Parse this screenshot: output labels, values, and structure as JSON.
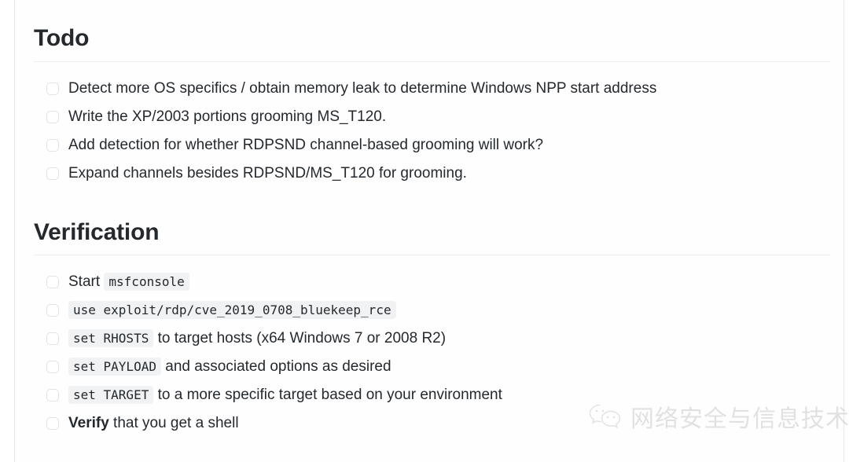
{
  "sections": [
    {
      "heading": "Todo",
      "items": [
        {
          "parts": [
            {
              "type": "text",
              "value": "Detect more OS specifics / obtain memory leak to determine Windows NPP start address"
            }
          ]
        },
        {
          "parts": [
            {
              "type": "text",
              "value": "Write the XP/2003 portions grooming MS_T120."
            }
          ]
        },
        {
          "parts": [
            {
              "type": "text",
              "value": "Add detection for whether RDPSND channel-based grooming will work?"
            }
          ]
        },
        {
          "parts": [
            {
              "type": "text",
              "value": "Expand channels besides RDPSND/MS_T120 for grooming."
            }
          ]
        }
      ]
    },
    {
      "heading": "Verification",
      "items": [
        {
          "parts": [
            {
              "type": "text",
              "value": "Start "
            },
            {
              "type": "code",
              "value": "msfconsole"
            }
          ]
        },
        {
          "parts": [
            {
              "type": "code",
              "value": "use exploit/rdp/cve_2019_0708_bluekeep_rce"
            }
          ]
        },
        {
          "parts": [
            {
              "type": "code",
              "value": "set RHOSTS"
            },
            {
              "type": "text",
              "value": " to target hosts (x64 Windows 7 or 2008 R2)"
            }
          ]
        },
        {
          "parts": [
            {
              "type": "code",
              "value": "set PAYLOAD"
            },
            {
              "type": "text",
              "value": " and associated options as desired"
            }
          ]
        },
        {
          "parts": [
            {
              "type": "code",
              "value": "set TARGET"
            },
            {
              "type": "text",
              "value": " to a more specific target based on your environment"
            }
          ]
        },
        {
          "parts": [
            {
              "type": "bold",
              "value": "Verify"
            },
            {
              "type": "text",
              "value": " that you get a shell"
            }
          ]
        }
      ]
    }
  ],
  "watermark": {
    "icon": "wechat-logo-icon",
    "text": "网络安全与信息技术",
    "color": "#c9cbcd"
  },
  "colors": {
    "text": "#24292e",
    "rule": "#eaecef",
    "code_background": "#f1f2f3",
    "checkbox_border": "#e0e2e5",
    "frame_border": "#e6e8ea"
  }
}
